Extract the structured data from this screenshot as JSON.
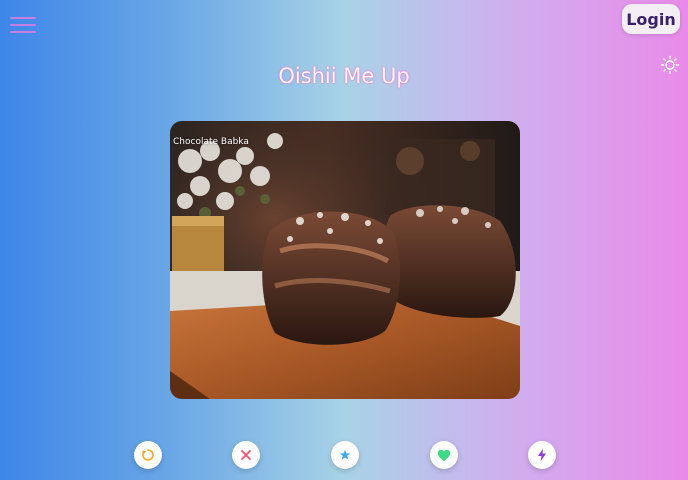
{
  "header": {
    "login_label": "Login"
  },
  "page": {
    "title": "Oishii Me Up"
  },
  "card": {
    "caption": "Chocolate Babka"
  },
  "actions": [
    {
      "name": "rewind",
      "icon": "rewind-icon",
      "color": "#f5a623"
    },
    {
      "name": "nope",
      "icon": "close-icon",
      "color": "#ff4d6d"
    },
    {
      "name": "super-like",
      "icon": "star-icon",
      "color": "#3fa9f5"
    },
    {
      "name": "like",
      "icon": "heart-icon",
      "color": "#3ddc84"
    },
    {
      "name": "boost",
      "icon": "lightning-icon",
      "color": "#8e3fd8"
    }
  ],
  "icons": {
    "menu": "hamburger-menu-icon",
    "theme": "sun-icon"
  },
  "colors": {
    "title_glow": "#f26bd1",
    "login_text": "#3a1f6b",
    "menu": "#c77ee0"
  }
}
